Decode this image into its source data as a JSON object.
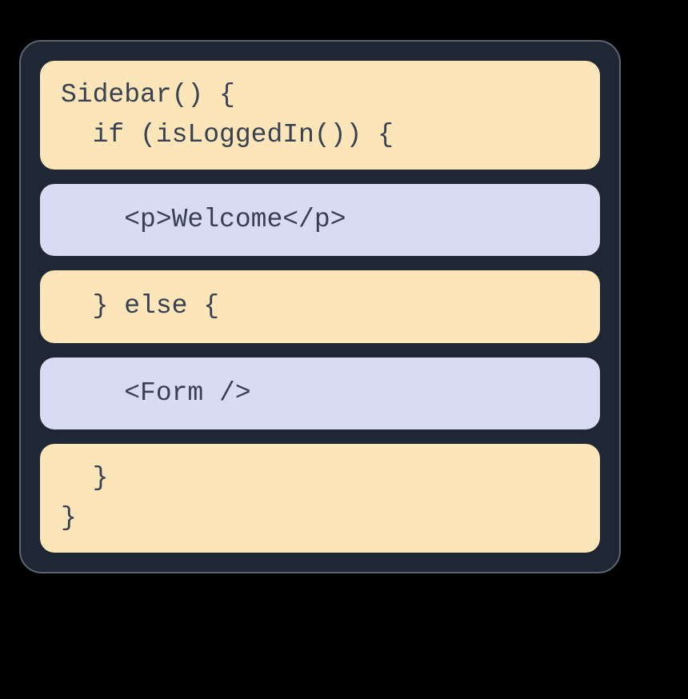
{
  "blocks": [
    {
      "type": "orange",
      "lines": [
        "Sidebar() {",
        "  if (isLoggedIn()) {"
      ]
    },
    {
      "type": "purple",
      "lines": [
        "    <p>Welcome</p>"
      ]
    },
    {
      "type": "orange",
      "lines": [
        "  } else {"
      ]
    },
    {
      "type": "purple",
      "lines": [
        "    <Form />"
      ]
    },
    {
      "type": "orange",
      "lines": [
        "  }",
        "}"
      ]
    }
  ]
}
